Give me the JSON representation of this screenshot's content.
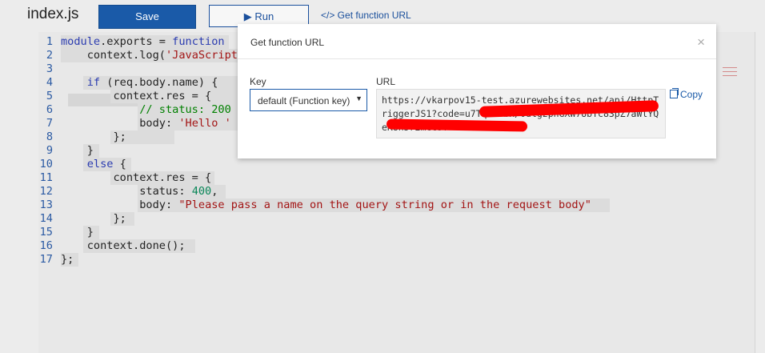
{
  "toolbar": {
    "file_title": "index.js",
    "save_label": "Save",
    "run_label": "▶ Run",
    "get_url_label": "</> Get function URL"
  },
  "editor": {
    "lines": [
      {
        "n": "1",
        "segs": [
          [
            "kw",
            "module"
          ],
          [
            "pl",
            ".exports = "
          ],
          [
            "kw",
            "function"
          ]
        ]
      },
      {
        "n": "2",
        "segs": [
          [
            "pl",
            "    context.log("
          ],
          [
            "str",
            "'JavaScript"
          ]
        ]
      },
      {
        "n": "3",
        "segs": [
          [
            "pl",
            ""
          ]
        ]
      },
      {
        "n": "4",
        "segs": [
          [
            "pl",
            "    "
          ],
          [
            "kw",
            "if"
          ],
          [
            "pl",
            " (req.body.name) {"
          ]
        ]
      },
      {
        "n": "5",
        "segs": [
          [
            "pl",
            "        context.res = {"
          ]
        ]
      },
      {
        "n": "6",
        "segs": [
          [
            "com",
            "            // status: 200"
          ]
        ]
      },
      {
        "n": "7",
        "segs": [
          [
            "pl",
            "            body: "
          ],
          [
            "str",
            "'Hello '"
          ]
        ]
      },
      {
        "n": "8",
        "segs": [
          [
            "pl",
            "        };"
          ]
        ]
      },
      {
        "n": "9",
        "segs": [
          [
            "pl",
            "    }"
          ]
        ]
      },
      {
        "n": "10",
        "segs": [
          [
            "pl",
            "    "
          ],
          [
            "kw",
            "else"
          ],
          [
            "pl",
            " {"
          ]
        ]
      },
      {
        "n": "11",
        "segs": [
          [
            "pl",
            "        context.res = {"
          ]
        ]
      },
      {
        "n": "12",
        "segs": [
          [
            "pl",
            "            status: "
          ],
          [
            "num",
            "400"
          ],
          [
            "pl",
            ","
          ]
        ]
      },
      {
        "n": "13",
        "segs": [
          [
            "pl",
            "            body: "
          ],
          [
            "str",
            "\"Please pass a name on the query string or in the request body\""
          ]
        ]
      },
      {
        "n": "14",
        "segs": [
          [
            "pl",
            "        };"
          ]
        ]
      },
      {
        "n": "15",
        "segs": [
          [
            "pl",
            "    }"
          ]
        ]
      },
      {
        "n": "16",
        "segs": [
          [
            "pl",
            "    context.done();"
          ]
        ]
      },
      {
        "n": "17",
        "segs": [
          [
            "pl",
            "};"
          ]
        ]
      }
    ]
  },
  "modal": {
    "title": "Get function URL",
    "close": "×",
    "key_label": "Key",
    "key_selected": "default (Function key)",
    "url_label": "URL",
    "url_value": "https://vkarpov15-test.azurewebsites.net/api/HttpTriggerJS1?code=u7TqYmVbH/0dlgzpnGXW7UbTc83pZ7aWlYQeK8nJr2mcC9f==",
    "copy_label": "Copy"
  },
  "colors": {
    "save_bg": "#1a5aa8",
    "link": "#1a4f9c",
    "redaction": "#ff0000"
  }
}
